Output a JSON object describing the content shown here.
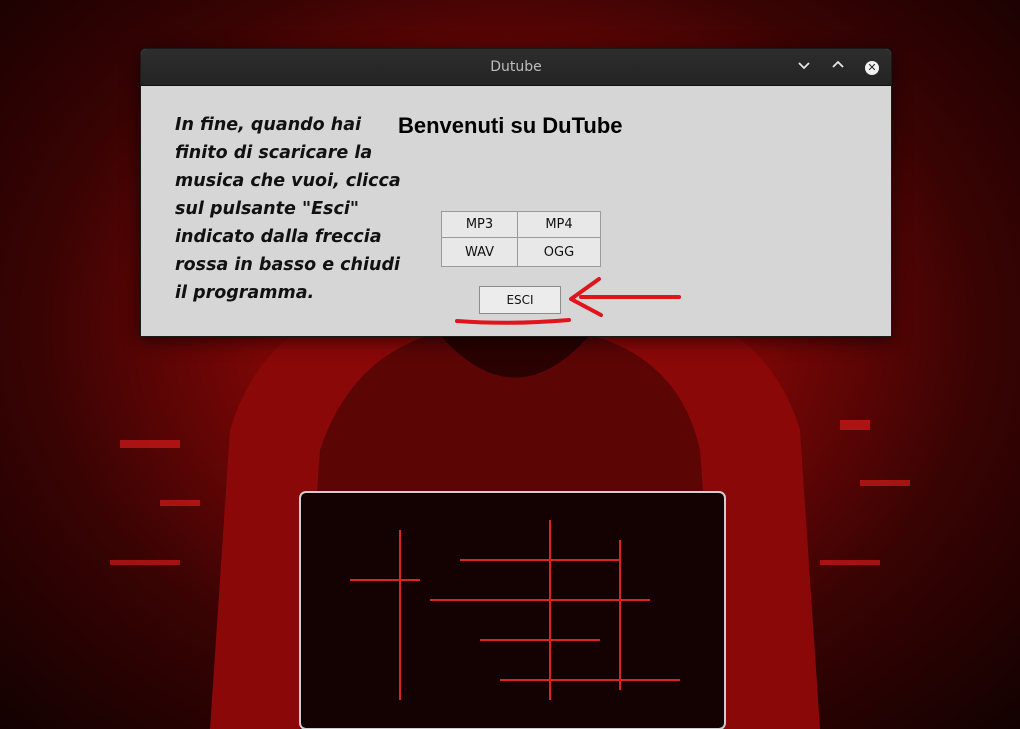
{
  "window": {
    "title": "Dutube",
    "controls": {
      "minimize_icon": "chevron-down",
      "maximize_icon": "chevron-up",
      "close_icon": "close-x"
    }
  },
  "content": {
    "instructions": "In fine, quando hai finito di scaricare la musica che vuoi, clicca sul pulsante \"Esci\" indicato dalla freccia rossa in basso e chiudi il programma.",
    "welcome_title": "Benvenuti su DuTube",
    "format_buttons": [
      "MP3",
      "MP4",
      "WAV",
      "OGG"
    ],
    "exit_button": "ESCI"
  },
  "colors": {
    "annotation_red": "#e0141a",
    "window_bg": "#d6d6d6",
    "titlebar_bg": "#262626"
  }
}
